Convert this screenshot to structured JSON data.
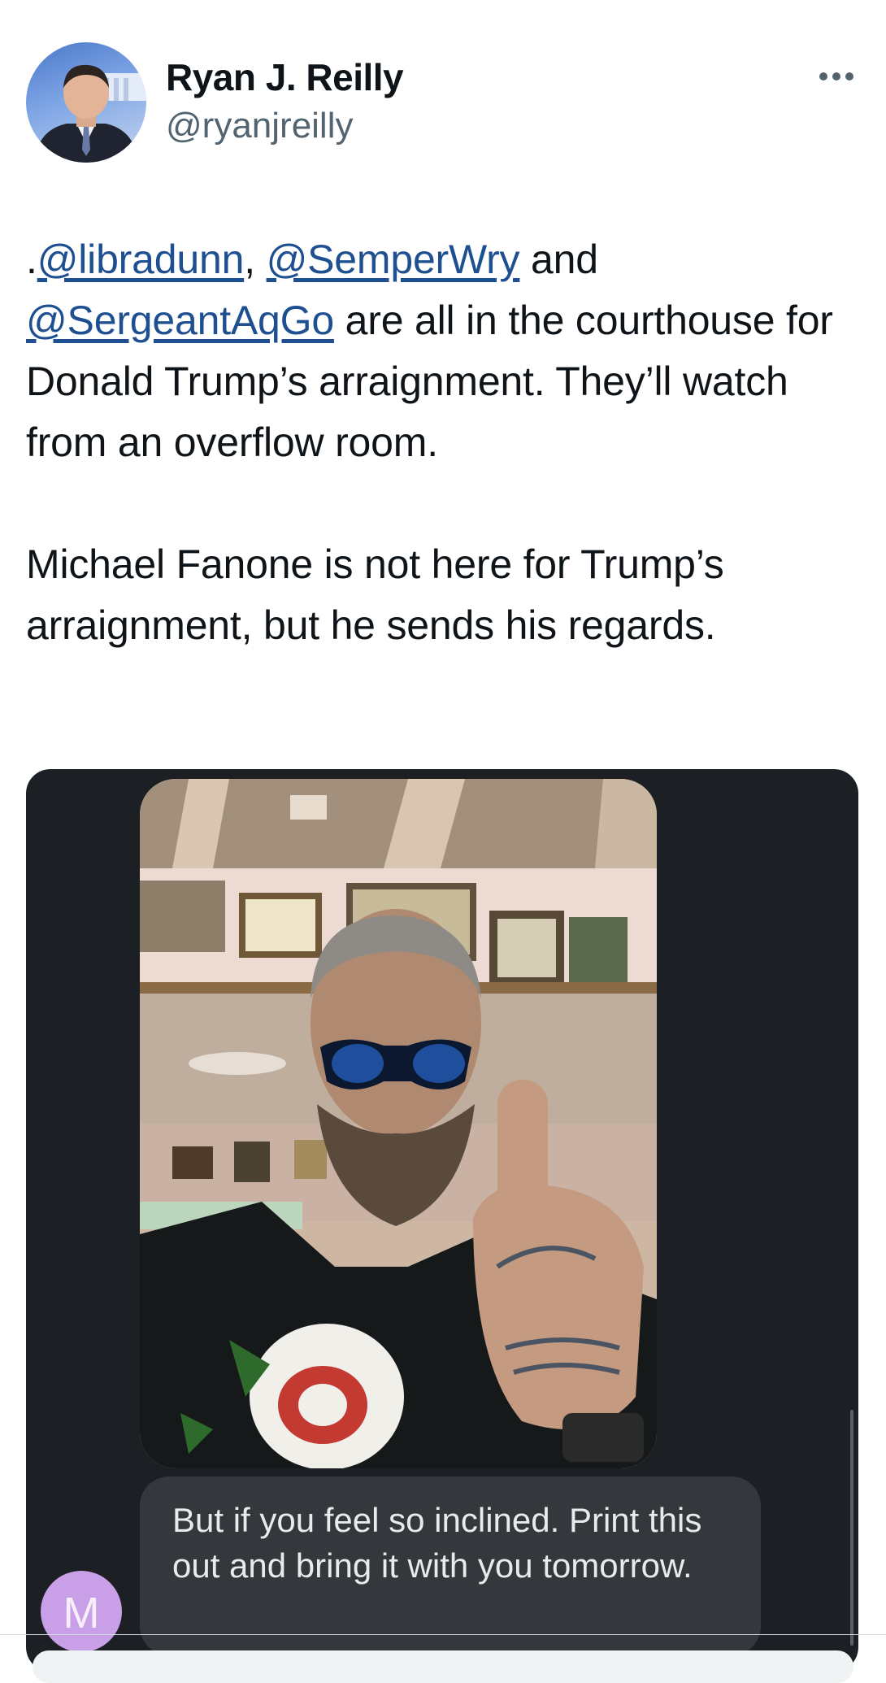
{
  "author": {
    "name": "Ryan J. Reilly",
    "handle": "@ryanjreilly"
  },
  "tweet": {
    "lead": ".",
    "mention1": "@libradunn",
    "sep1": ", ",
    "mention2": "@SemperWry",
    "sep2": " and ",
    "mention3": "@SergeantAqGo",
    "rest1": " are all in the courthouse for Donald Trump’s arraignment. They’ll watch from an overflow room.",
    "paragraph2": "Michael Fanone is not here for Trump’s arraignment, but he sends his regards."
  },
  "message": {
    "text": "But if you feel so inclined. Print this out and bring it with you tomorrow.",
    "sender_initial": "M"
  },
  "icons": {
    "more": "more-horizontal-icon"
  },
  "colors": {
    "link": "#1d4f91",
    "handle_gray": "#536471",
    "media_bg": "#1c1f24",
    "bubble_bg": "#34373c",
    "sender_avatar": "#c9a0e8"
  }
}
